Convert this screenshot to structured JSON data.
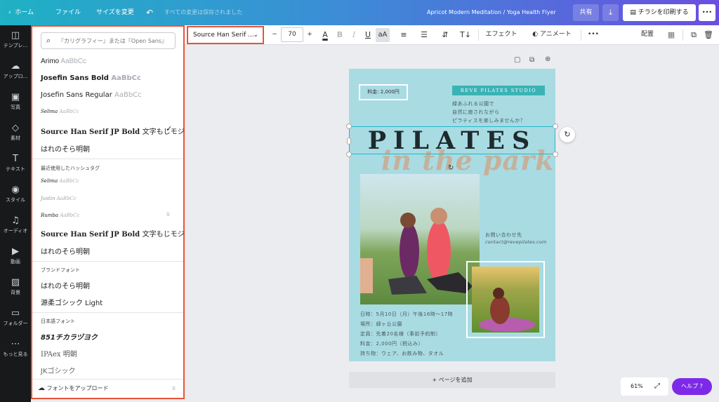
{
  "topbar": {
    "home": "ホーム",
    "file": "ファイル",
    "resize": "サイズを変更",
    "undo_icon": "undo-icon",
    "saved_status": "すべての変更は保存されました",
    "doc_title": "Apricot Modern Meditation / Yoga Health Flyer",
    "share": "共有",
    "print": "チラシを印刷する",
    "more": "•••"
  },
  "sidebar": {
    "items": [
      {
        "label": "テンプレ..."
      },
      {
        "label": "アップロ..."
      },
      {
        "label": "写真"
      },
      {
        "label": "素材"
      },
      {
        "label": "テキスト"
      },
      {
        "label": "スタイル"
      },
      {
        "label": "オーディオ"
      },
      {
        "label": "動画"
      },
      {
        "label": "背景"
      },
      {
        "label": "フォルダー"
      },
      {
        "label": "もっと見る"
      }
    ]
  },
  "font_panel": {
    "search_placeholder": "『カリグラフィー』または『Open Sans』",
    "fonts_top": [
      {
        "name": "Arimo",
        "sample": "AaBbCc"
      },
      {
        "name": "Josefin Sans Bold",
        "sample": "AaBbCc"
      },
      {
        "name": "Josefin Sans Regular",
        "sample": "AaBbCc"
      },
      {
        "name": "Selima",
        "sample": "AaBbCc"
      },
      {
        "name": "Source Han Serif JP Bold",
        "sample": "文字もじモジ"
      },
      {
        "name": "はれのそら明朝",
        "sample": ""
      }
    ],
    "recent_heading": "最近使用したハッシュタグ",
    "fonts_recent": [
      {
        "name": "Selima",
        "sample": "AaBbCc"
      },
      {
        "name": "Justin",
        "sample": "AaBbCc"
      },
      {
        "name": "Rumba",
        "sample": "AaBbCc"
      },
      {
        "name": "Source Han Serif JP Bold",
        "sample": "文字もじモジ"
      },
      {
        "name": "はれのそら明朝",
        "sample": ""
      }
    ],
    "brand_heading": "ブランドフォント",
    "fonts_brand": [
      {
        "name": "はれのそら明朝"
      },
      {
        "name": "源柔ゴシック Light"
      }
    ],
    "jp_heading": "日本語フォント",
    "fonts_jp": [
      {
        "name": "851チカラヅヨク"
      },
      {
        "name": "IPAex 明朝"
      },
      {
        "name": "JKゴシック"
      }
    ],
    "upload": "フォントをアップロード"
  },
  "toolbar": {
    "font_name": "Source Han Serif ...",
    "minus": "−",
    "font_size": "70",
    "plus": "+",
    "effects": "エフェクト",
    "animate": "アニメート",
    "more": "•••",
    "position": "配置"
  },
  "flyer": {
    "price_box": "料金: 2,000円",
    "studio": "REVE PILATES STUDIO",
    "tagline": [
      "緑あふれる公園で",
      "自然に癒されながら",
      "ピラティスを楽しみませんか？"
    ],
    "title": "PILATES",
    "subtitle": "in the park",
    "contact_label": "お問い合わせ先",
    "contact_email": "contact@revepilates.com",
    "details": [
      "日時：5月10日（月）午後16時〜17時",
      "場所：緑ヶ丘公園",
      "定員：先着20名様（事前予約制）",
      "料金：2,000円（税込み）",
      "持ち物：ウェア、お飲み物、タオル"
    ]
  },
  "add_page": "+ ページを追加",
  "zoom": "61%",
  "help": "ヘルプ ?"
}
